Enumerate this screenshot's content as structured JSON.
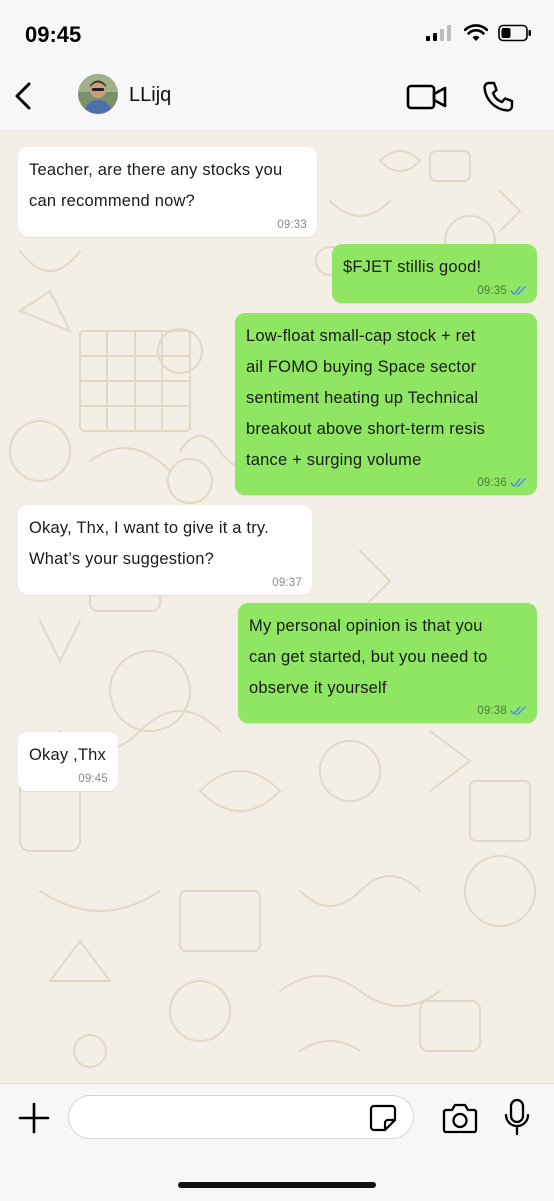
{
  "status_bar": {
    "time": "09:45",
    "icons": [
      "cellular-signal-icon",
      "wifi-icon",
      "battery-icon"
    ]
  },
  "header": {
    "back_icon": "chevron-left-icon",
    "contact_name": "LLijq",
    "video_icon": "video-camera-icon",
    "call_icon": "phone-icon"
  },
  "messages": [
    {
      "direction": "in",
      "text": "Teacher, are there any stocks you\ncan recommend now?",
      "time": "09:33"
    },
    {
      "direction": "out",
      "text": "$FJET stillis good!",
      "time": "09:35",
      "read": true
    },
    {
      "direction": "out",
      "text": "Low-float small-cap stock + ret\nail FOMO buying  Space sector\nsentiment heating up  Technical\nbreakout above short-term resis\ntance + surging volume",
      "time": "09:36",
      "read": true
    },
    {
      "direction": "in",
      "text": "Okay, Thx,  I want to give it a try.\nWhat’s your suggestion?",
      "time": "09:37"
    },
    {
      "direction": "out",
      "text": "My personal opinion is that you\ncan get started, but you need to\n observe it yourself",
      "time": "09:38",
      "read": true
    },
    {
      "direction": "in",
      "text": "Okay ,Thx",
      "time": "09:45"
    }
  ],
  "input_bar": {
    "placeholder": "",
    "icons": [
      "plus-icon",
      "sticker-icon",
      "camera-icon",
      "microphone-icon"
    ]
  },
  "colors": {
    "outgoing_bubble": "#8fe663",
    "incoming_bubble": "#ffffff",
    "chat_background": "#f3efe6",
    "read_receipt": "#4a90e2"
  }
}
